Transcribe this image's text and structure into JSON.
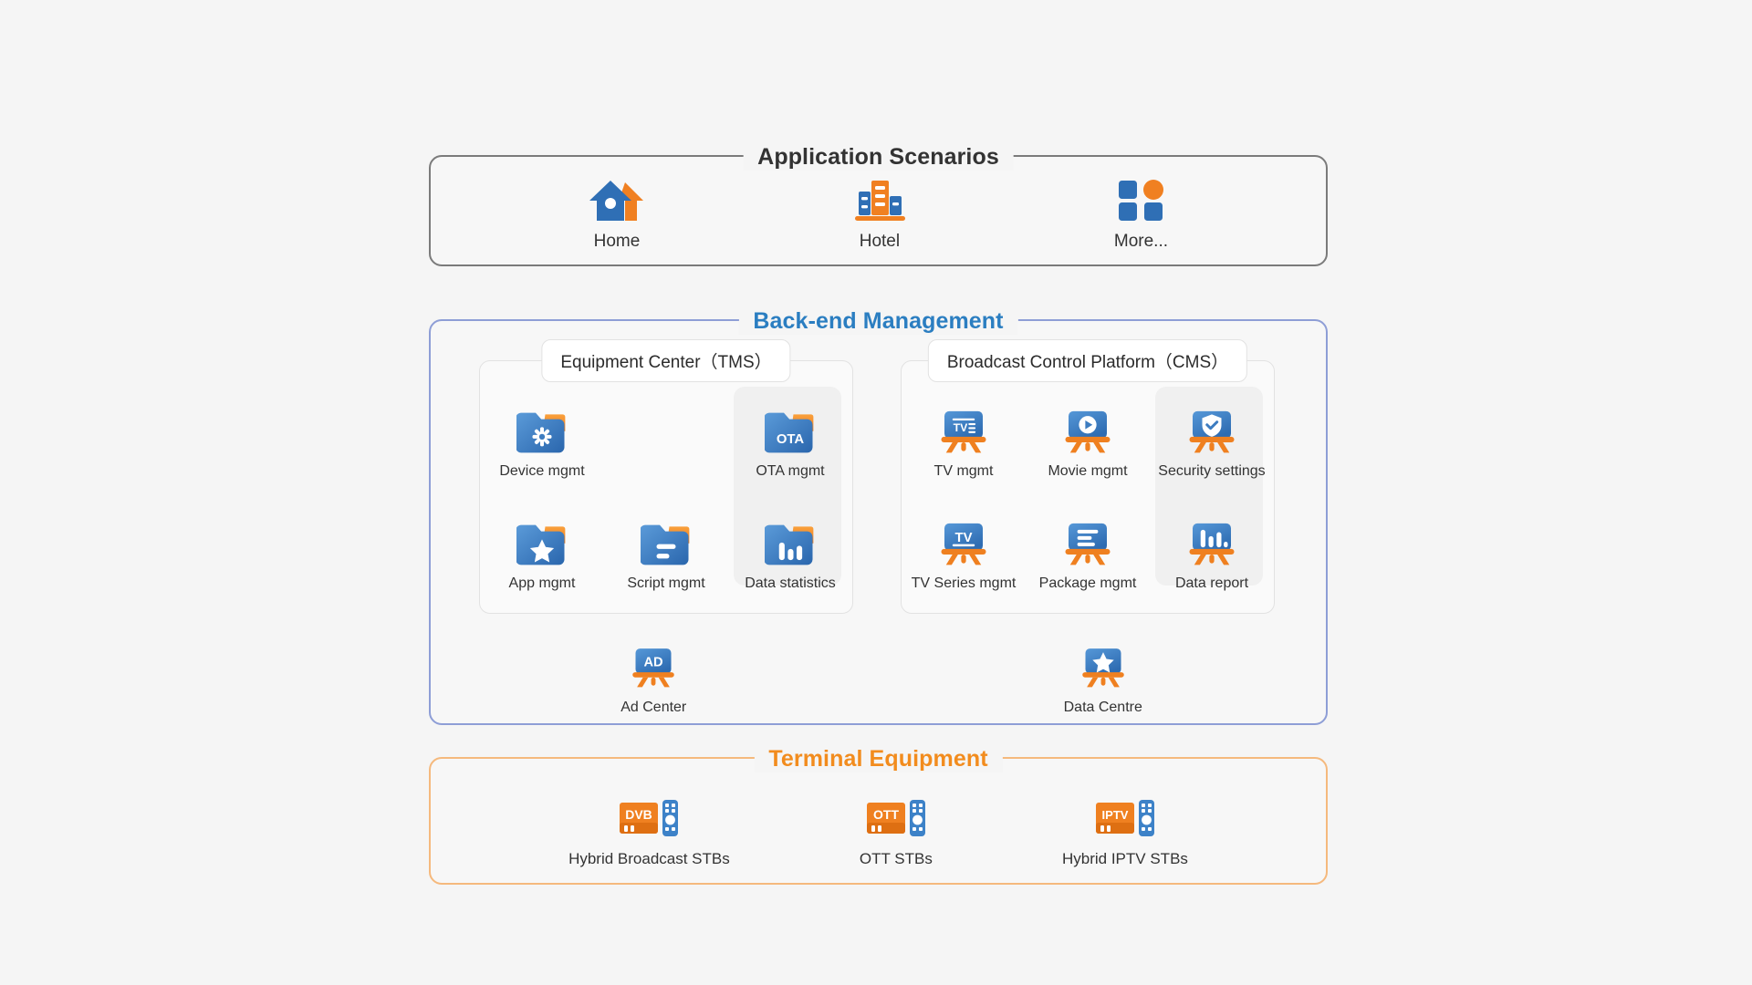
{
  "sections": {
    "scenarios": {
      "title": "Application Scenarios",
      "border_color": "#7b7b7b",
      "title_color": "#333333",
      "items": [
        {
          "label": "Home",
          "icon": "home-icon"
        },
        {
          "label": "Hotel",
          "icon": "hotel-icon"
        },
        {
          "label": "More...",
          "icon": "more-grid-icon"
        }
      ]
    },
    "backend": {
      "title": "Back-end Management",
      "border_color": "#8e9ed6",
      "title_color": "#2b7ec1",
      "tms": {
        "chip": "Equipment Center（TMS）",
        "items": [
          {
            "label": "Device mgmt",
            "icon": "folder-gear-icon",
            "highlighted": false
          },
          {
            "label": "",
            "icon": "",
            "highlighted": false
          },
          {
            "label": "OTA mgmt",
            "icon": "folder-ota-icon",
            "highlighted": true
          },
          {
            "label": "App mgmt",
            "icon": "folder-star-icon",
            "highlighted": false
          },
          {
            "label": "Script mgmt",
            "icon": "folder-lines-icon",
            "highlighted": false
          },
          {
            "label": "Data statistics",
            "icon": "folder-chart-icon",
            "highlighted": true
          }
        ]
      },
      "cms": {
        "chip": "Broadcast Control Platform（CMS）",
        "items": [
          {
            "label": "TV mgmt",
            "icon": "easel-tv-icon",
            "highlighted": false
          },
          {
            "label": "Movie mgmt",
            "icon": "easel-play-icon",
            "highlighted": false
          },
          {
            "label": "Security settings",
            "icon": "easel-shield-icon",
            "highlighted": true
          },
          {
            "label": "TV Series mgmt",
            "icon": "easel-tv2-icon",
            "highlighted": false
          },
          {
            "label": "Package mgmt",
            "icon": "easel-lines-icon",
            "highlighted": false
          },
          {
            "label": "Data report",
            "icon": "easel-chart-icon",
            "highlighted": true
          }
        ]
      },
      "bottom": [
        {
          "label": "Ad Center",
          "icon": "easel-ad-icon"
        },
        {
          "label": "Data Centre",
          "icon": "easel-star-icon"
        }
      ]
    },
    "terminal": {
      "title": "Terminal Equipment",
      "border_color": "#f5b97d",
      "title_color": "#f28c1e",
      "items": [
        {
          "label": "Hybrid Broadcast STBs",
          "icon": "stb-dvb-icon",
          "badge": "DVB"
        },
        {
          "label": "OTT STBs",
          "icon": "stb-ott-icon",
          "badge": "OTT"
        },
        {
          "label": "Hybrid IPTV STBs",
          "icon": "stb-iptv-icon",
          "badge": "IPTV"
        }
      ]
    }
  },
  "icon_text": {
    "ota": "OTA",
    "tv": "TV",
    "tv2": "TV",
    "ad": "AD",
    "dvb": "DVB",
    "ott": "OTT",
    "iptv": "IPTV"
  },
  "colors": {
    "background": "#f5f5f5",
    "blue": "#2f6fb5",
    "blue_light": "#4a8fd0",
    "orange": "#f08021",
    "orange_light": "#f9a03c",
    "text": "#333333",
    "panel_fill": "#f7f7f7",
    "highlight_fill": "#f0f0f0"
  }
}
